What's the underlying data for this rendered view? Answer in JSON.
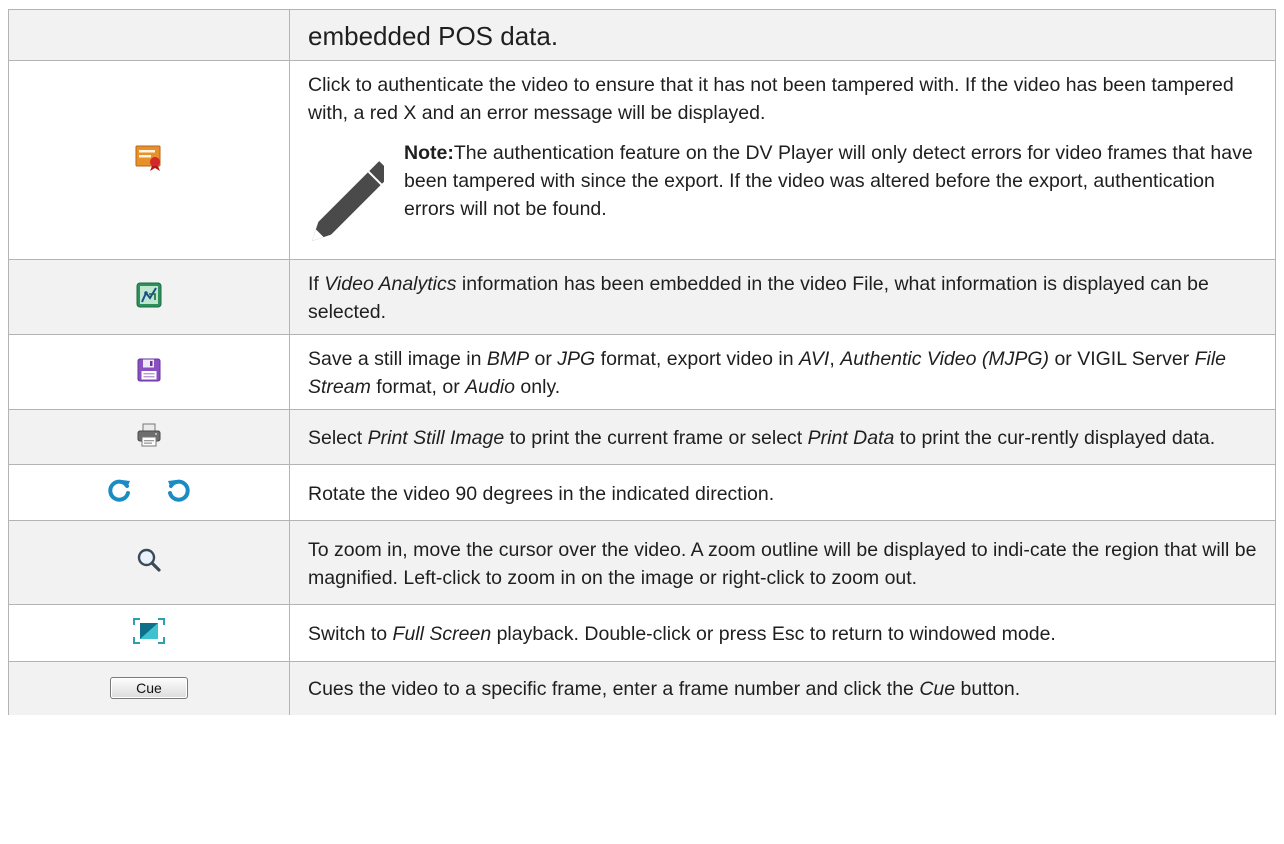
{
  "rows": [
    {
      "icon": null,
      "segments": [
        {
          "t": "embedded POS data."
        }
      ]
    },
    {
      "icon": "certificate-icon",
      "segments": [
        {
          "t": "Click to authenticate the video to ensure that it has not been tampered with. If the video has been tampered with, a red X and an error message will be displayed."
        }
      ],
      "note": {
        "label": "Note:",
        "text": "The authentication feature on the DV Player will only detect errors for video frames that have been tampered with since the export. If the video was altered before the export, authentication errors will not be found."
      }
    },
    {
      "icon": "video-analytics-icon",
      "segments": [
        {
          "t": "If "
        },
        {
          "t": "Video Analytics",
          "i": true
        },
        {
          "t": " information has been embedded in the video File, what information is displayed can be selected."
        }
      ]
    },
    {
      "icon": "save-icon",
      "segments": [
        {
          "t": "Save a still image in "
        },
        {
          "t": "BMP",
          "i": true
        },
        {
          "t": " or "
        },
        {
          "t": "JPG",
          "i": true
        },
        {
          "t": " format, export video in "
        },
        {
          "t": "AVI",
          "i": true
        },
        {
          "t": ", "
        },
        {
          "t": "Authentic Video (MJPG)",
          "i": true
        },
        {
          "t": " or VIGIL Server "
        },
        {
          "t": "File Stream",
          "i": true
        },
        {
          "t": " format, or "
        },
        {
          "t": "Audio",
          "i": true
        },
        {
          "t": " only."
        }
      ]
    },
    {
      "icon": "print-icon",
      "segments": [
        {
          "t": "Select "
        },
        {
          "t": "Print Still Image",
          "i": true
        },
        {
          "t": " to print the current frame or select "
        },
        {
          "t": "Print Data",
          "i": true
        },
        {
          "t": " to print the cur-rently displayed data."
        }
      ]
    },
    {
      "icon": "rotate-icons",
      "segments": [
        {
          "t": "Rotate the video 90 degrees in the indicated direction."
        }
      ]
    },
    {
      "icon": "zoom-icon",
      "segments": [
        {
          "t": "To zoom in, move the cursor over the video. A zoom outline will be displayed to indi-cate the region that will be magnified. Left-click to zoom in on the image or right-click to zoom out."
        }
      ]
    },
    {
      "icon": "fullscreen-icon",
      "segments": [
        {
          "t": "Switch to "
        },
        {
          "t": "Full Screen",
          "i": true
        },
        {
          "t": " playback.  Double-click or press Esc to return to windowed mode."
        }
      ]
    },
    {
      "icon": "cue-button",
      "cue_label": "Cue",
      "segments": [
        {
          "t": "Cues the video to a specific frame, enter a frame number and click the "
        },
        {
          "t": "Cue",
          "i": true
        },
        {
          "t": " button."
        }
      ]
    }
  ]
}
